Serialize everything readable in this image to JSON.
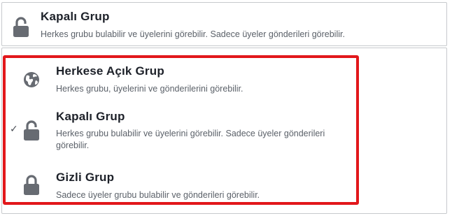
{
  "selected": {
    "title": "Kapalı Grup",
    "description": "Herkes grubu bulabilir ve üyelerini görebilir. Sadece üyeler gönderileri görebilir.",
    "icon": "padlock-icon"
  },
  "options": [
    {
      "title": "Herkese Açık Grup",
      "description": "Herkes grubu, üyelerini ve gönderilerini görebilir.",
      "icon": "globe-icon",
      "selected": false
    },
    {
      "title": "Kapalı Grup",
      "description": "Herkes grubu bulabilir ve üyelerini görebilir. Sadece üyeler gönderileri görebilir.",
      "icon": "padlock-icon",
      "selected": true
    },
    {
      "title": "Gizli Grup",
      "description": "Sadece üyeler grubu bulabilir ve gönderileri görebilir.",
      "icon": "padlock-icon",
      "selected": false
    }
  ],
  "checkmark": "✓",
  "colors": {
    "highlight_border": "#e2171b",
    "icon_gray": "#676b72",
    "title_text": "#1d2129",
    "description_text": "#5b6169"
  }
}
